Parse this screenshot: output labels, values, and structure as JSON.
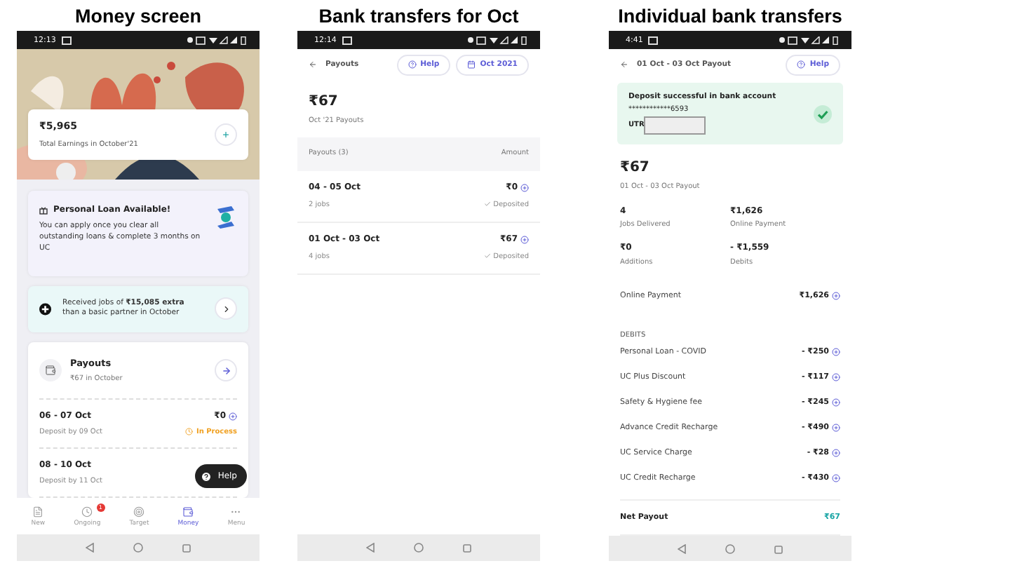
{
  "money_screen": {
    "heading": "Money screen",
    "time": "12:13",
    "earnings": {
      "amount": "₹5,965",
      "label": "Total Earnings in October'21"
    },
    "loan": {
      "title": "Personal Loan Available!",
      "text": "You can apply once you clear all outstanding loans & complete 3 months on UC"
    },
    "extra": {
      "text": "Received jobs of **₹15,085 extra** than a basic partner in October"
    },
    "payouts": {
      "title": "Payouts",
      "subtitle": "₹67 in October",
      "rows": [
        {
          "period": "06 - 07 Oct",
          "amount": "₹0",
          "note": "Deposit by 09 Oct",
          "status": "In Process"
        },
        {
          "period": "08 - 10 Oct",
          "note": "Deposit by 11 Oct"
        }
      ]
    },
    "help": "Help",
    "nav": [
      {
        "label": "New",
        "kind": "new",
        "selected": false
      },
      {
        "label": "Ongoing",
        "kind": "ongoing",
        "selected": false,
        "badge": "1"
      },
      {
        "label": "Target",
        "kind": "target",
        "selected": false
      },
      {
        "label": "Money",
        "kind": "money",
        "selected": true
      },
      {
        "label": "Menu",
        "kind": "menu",
        "selected": false
      }
    ]
  },
  "bank_transfers_screen": {
    "heading": "Bank transfers for Oct",
    "time": "12:14",
    "title": "Payouts",
    "help": "Help",
    "month": "Oct 2021",
    "total": "₹67",
    "total_label": "Oct '21 Payouts",
    "columns": [
      "Payouts (3)",
      "Amount"
    ],
    "rows": [
      {
        "period": "04 - 05 Oct",
        "amount": "₹0",
        "jobs": "2 jobs",
        "status": "Deposited"
      },
      {
        "period": "01 Oct - 03 Oct",
        "amount": "₹67",
        "jobs": "4 jobs",
        "status": "Deposited"
      }
    ]
  },
  "individual_transfers_screen": {
    "heading": "Individual bank transfers",
    "time": "4:41",
    "title": "01 Oct - 03 Oct Payout",
    "help": "Help",
    "banner": {
      "message": "Deposit successful in bank account",
      "account": "************6593",
      "utr_label": "UTR"
    },
    "total": "₹67",
    "total_label": "01 Oct - 03 Oct Payout",
    "stats": [
      {
        "value": "4",
        "label": "Jobs Delivered"
      },
      {
        "value": "₹1,626",
        "label": "Online Payment"
      },
      {
        "value": "₹0",
        "label": "Additions"
      },
      {
        "value": "- ₹1,559",
        "label": "Debits"
      }
    ],
    "online_payment": {
      "label": "Online Payment",
      "amount": "₹1,626"
    },
    "debits_heading": "DEBITS",
    "debits": [
      {
        "label": "Personal Loan - COVID",
        "amount": "- ₹250"
      },
      {
        "label": "UC Plus Discount",
        "amount": "- ₹117"
      },
      {
        "label": "Safety & Hygiene fee",
        "amount": "- ₹245"
      },
      {
        "label": "Advance Credit Recharge",
        "amount": "- ₹490"
      },
      {
        "label": "UC Service Charge",
        "amount": "- ₹28"
      },
      {
        "label": "UC Credit Recharge",
        "amount": "- ₹430"
      }
    ],
    "net": {
      "label": "Net Payout",
      "amount": "₹67"
    }
  }
}
